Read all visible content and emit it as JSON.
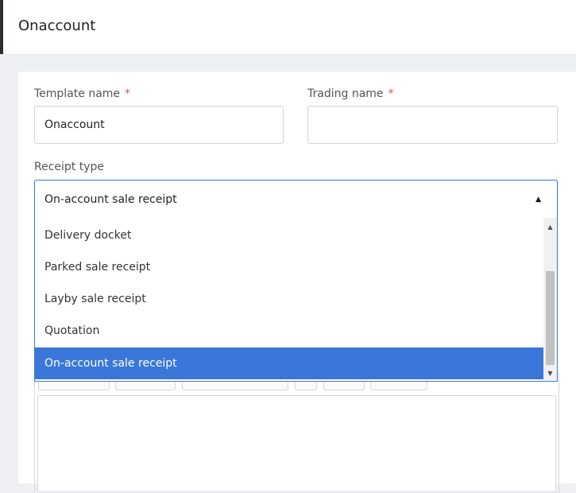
{
  "header": {
    "title": "Onaccount"
  },
  "form": {
    "template_name": {
      "label": "Template name",
      "required_mark": "*",
      "value": "Onaccount"
    },
    "trading_name": {
      "label": "Trading name",
      "required_mark": "*",
      "value": ""
    },
    "receipt_type": {
      "label": "Receipt type",
      "selected": "On-account sale receipt",
      "options": [
        "Delivery docket",
        "Parked sale receipt",
        "Layby sale receipt",
        "Quotation",
        "On-account sale receipt"
      ],
      "selected_index": 4
    }
  },
  "colors": {
    "accent": "#3a77d8",
    "required": "#d9534f"
  },
  "icons": {
    "caret": "caret-up-icon",
    "scroll_up": "scroll-up-icon",
    "scroll_down": "scroll-down-icon"
  }
}
